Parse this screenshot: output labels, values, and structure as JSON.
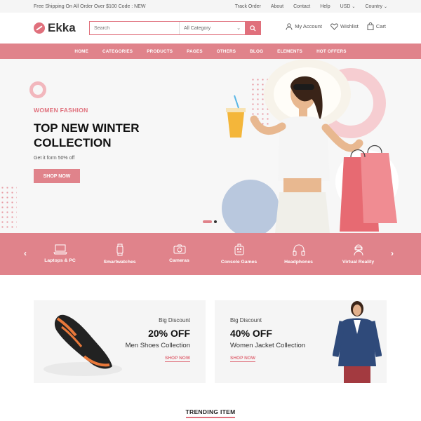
{
  "topbar": {
    "promo": "Free Shipping On All Order Over $100 Code : NEW",
    "links": [
      "Track Order",
      "About",
      "Contact",
      "Help"
    ],
    "currency": "USD",
    "country": "Country"
  },
  "header": {
    "logo": "Ekka",
    "search_placeholder": "Search",
    "category_select": "All Category",
    "account": "My Account",
    "wishlist": "Wishlist",
    "cart": "Cart"
  },
  "nav": [
    "HOME",
    "CATEGORIES",
    "PRODUCTS",
    "PAGES",
    "OTHERS",
    "BLOG",
    "ELEMENTS",
    "HOT OFFERS"
  ],
  "hero": {
    "subtitle": "WOMEN FASHION",
    "title": "TOP NEW WINTER COLLECTION",
    "description": "Get it form 50% off",
    "button": "SHOP NOW"
  },
  "categories": [
    {
      "label": "Laptops & PC",
      "icon": "laptop-icon"
    },
    {
      "label": "Smartwatches",
      "icon": "smartwatch-icon"
    },
    {
      "label": "Cameras",
      "icon": "camera-icon"
    },
    {
      "label": "Console Games",
      "icon": "gamepad-icon"
    },
    {
      "label": "Headphones",
      "icon": "headphones-icon"
    },
    {
      "label": "Virtual Reality",
      "icon": "vr-headset-icon"
    }
  ],
  "banners": [
    {
      "small": "Big Discount",
      "big": "20% OFF",
      "title": "Men Shoes Collection",
      "link": "SHOP NOW"
    },
    {
      "small": "Big Discount",
      "big": "40% OFF",
      "title": "Women Jacket Collection",
      "link": "SHOP NOW"
    }
  ],
  "trending": "TRENDING ITEM",
  "colors": {
    "accent": "#e0838b",
    "accent_dark": "#e0707c"
  }
}
